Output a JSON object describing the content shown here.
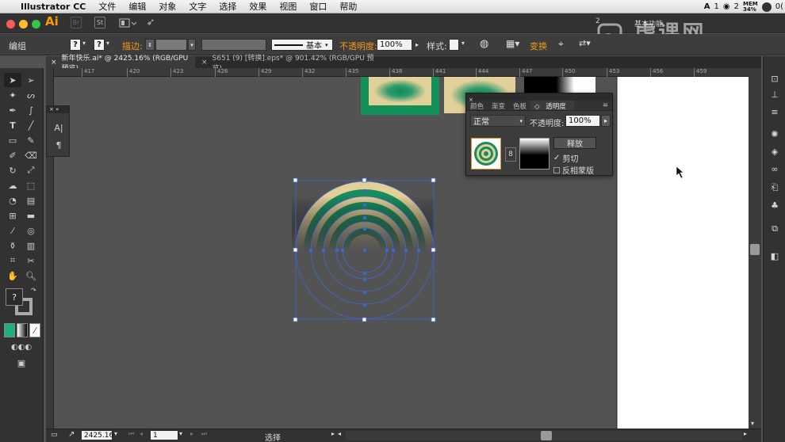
{
  "menubar": {
    "app_name": "Illustrator CC",
    "items": [
      "文件",
      "编辑",
      "对象",
      "文字",
      "选择",
      "效果",
      "视图",
      "窗口",
      "帮助"
    ],
    "status": {
      "a1": "1",
      "wifi_count": "2",
      "mem_label": "MEM",
      "mem_value": "34%",
      "extra": "0("
    }
  },
  "appbar": {
    "logo": "Ai",
    "br_label": "Br",
    "st_label": "St",
    "workspace_count": "2",
    "workspace": "基本功能"
  },
  "control": {
    "group_label": "编组",
    "stroke_label": "描边:",
    "stroke_style": "基本",
    "opacity_label": "不透明度:",
    "opacity_value": "100%",
    "style_label": "样式:",
    "transform_label": "变换"
  },
  "tabs": [
    {
      "label": "新年快乐.ai* @ 2425.16% (RGB/GPU 预览)"
    },
    {
      "label": "S651 (9) [转换].eps* @ 901.42% (RGB/GPU 预览)"
    }
  ],
  "ruler": {
    "ticks": [
      "417",
      "420",
      "423",
      "426",
      "429",
      "432",
      "435",
      "438",
      "441",
      "444",
      "447",
      "450",
      "453",
      "456",
      "459"
    ]
  },
  "transparency_panel": {
    "tabs": [
      "颜色",
      "渐变",
      "色板",
      "透明度"
    ],
    "blend_mode": "正常",
    "opacity_label": "不透明度:",
    "opacity_value": "100%",
    "release_label": "释放",
    "clip_label": "剪切",
    "invert_label": "反相蒙版",
    "clip_checked": true,
    "invert_checked": false
  },
  "statusbar": {
    "zoom": "2425.16",
    "page": "1",
    "tool": "选择"
  },
  "watermark": "虎课网",
  "colors": {
    "accent_orange": "#f49b1b",
    "green": "#1a8a5e",
    "cream": "#e6d199",
    "selection_blue": "#3d66cf"
  }
}
